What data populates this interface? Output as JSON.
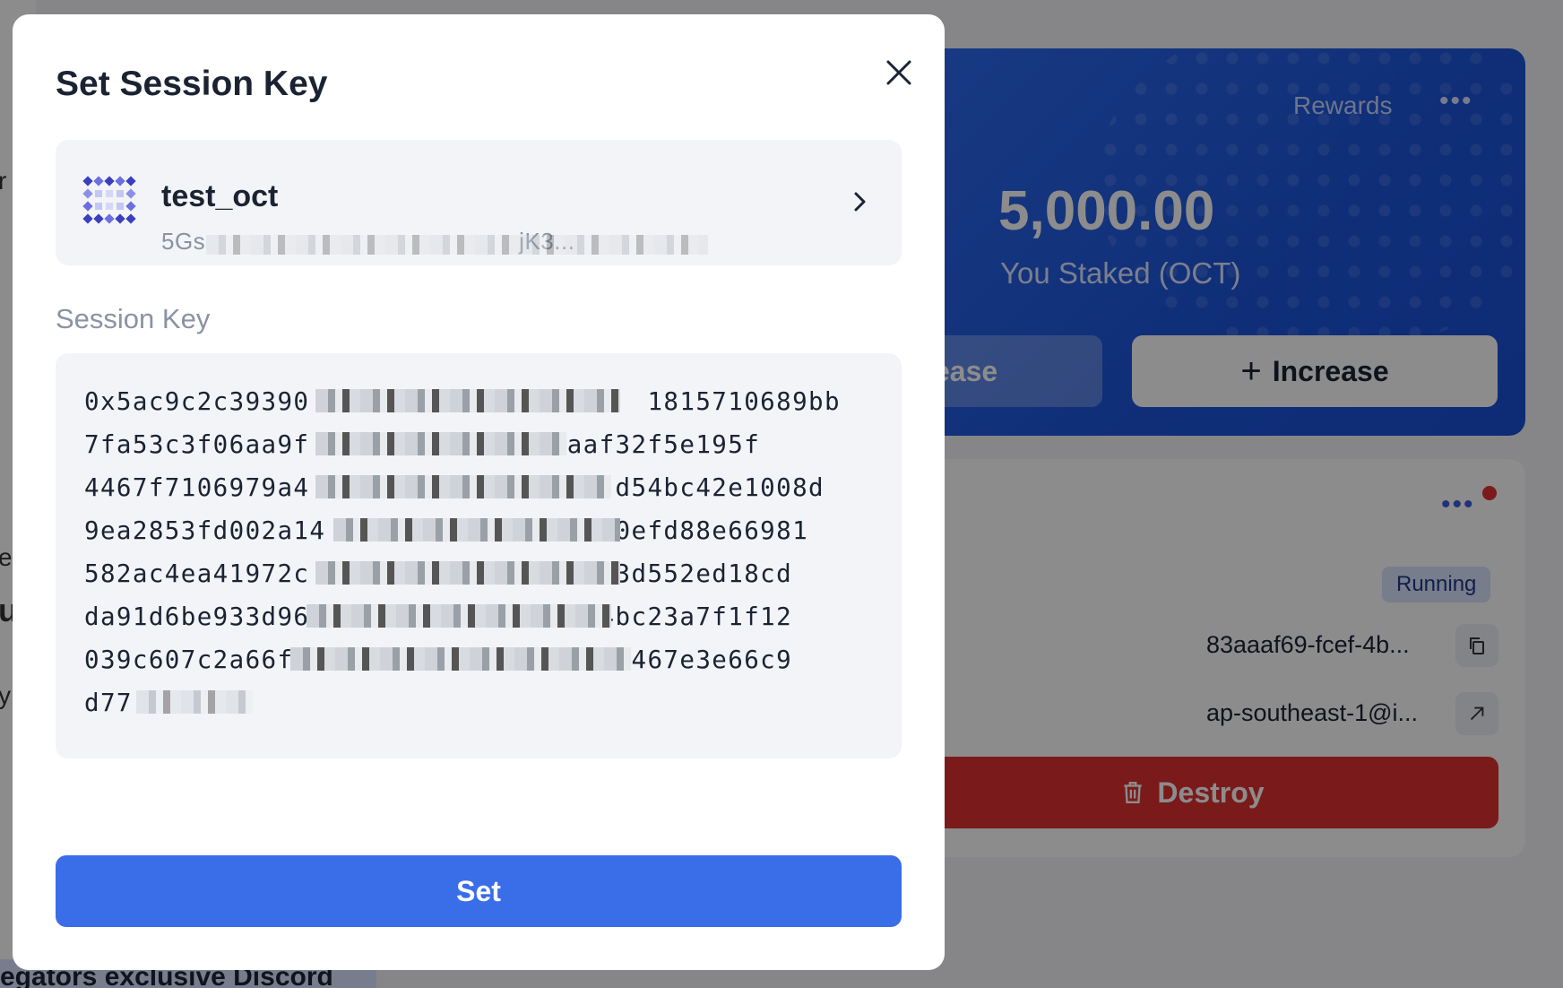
{
  "background": {
    "left_fragments": [
      "r",
      "e",
      "u",
      "y"
    ],
    "stake_card": {
      "rewards_label": "Rewards",
      "more_glyph": "•••",
      "staked_amount": "5,000.00",
      "staked_label": "You Staked (OCT)",
      "release_label": "ease",
      "increase_label": "Increase",
      "increase_icon": "+"
    },
    "node_card": {
      "more_glyph": "•••",
      "status": "Running",
      "node_id": "83aaaf69-fcef-4b...",
      "region": "ap-southeast-1@i...",
      "destroy_label": "Destroy"
    },
    "discord_banner": "egators exclusive Discord"
  },
  "modal": {
    "title": "Set Session Key",
    "account": {
      "name": "test_oct",
      "address": "5Gs                                                  jK3..."
    },
    "session_key_label": "Session Key",
    "session_key_lines": [
      "0x5ac9c2c39390                     1815710689bb",
      "7fa53c3f06aa9f             884aaf32f5e195f",
      "4467f7106979a4                   d54bc42e1008d",
      "9ea2853fd002a14                  0efd88e66981",
      "582ac4ea41972c                   3d552ed18cd",
      "da91d6be933d96                  4bc23a7f1f12",
      "039c607c2a66f                    e467e3e66c9",
      "d77"
    ],
    "set_label": "Set"
  }
}
